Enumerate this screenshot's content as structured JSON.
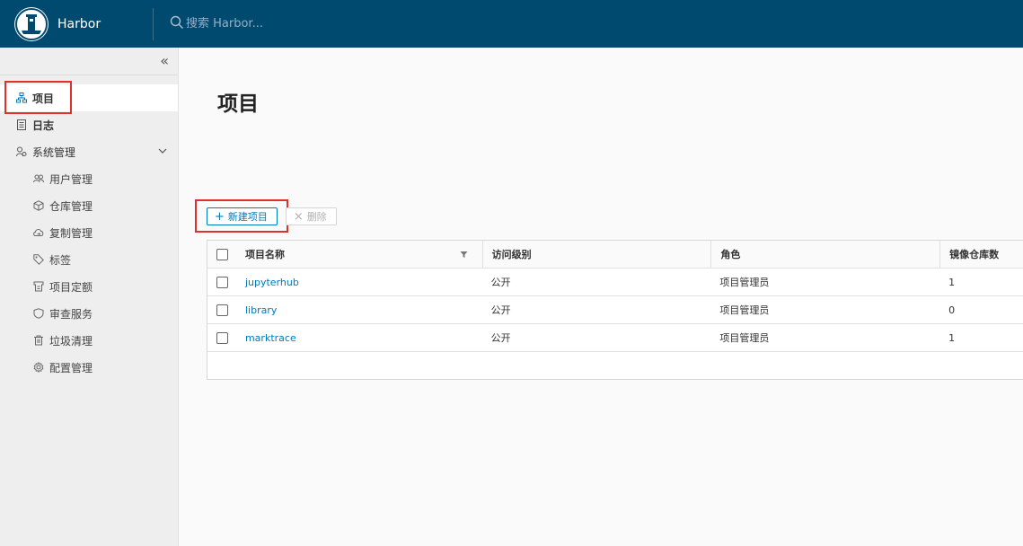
{
  "app": {
    "name": "Harbor"
  },
  "search": {
    "placeholder": "搜索 Harbor..."
  },
  "sidebar": {
    "collapse_icon": "«",
    "items": [
      {
        "label": "项目",
        "icon": "projects-icon"
      },
      {
        "label": "日志",
        "icon": "logs-icon"
      },
      {
        "label": "系统管理",
        "icon": "admin-icon"
      }
    ],
    "sub_items": [
      {
        "label": "用户管理",
        "icon": "users-icon"
      },
      {
        "label": "仓库管理",
        "icon": "registry-icon"
      },
      {
        "label": "复制管理",
        "icon": "replication-icon"
      },
      {
        "label": "标签",
        "icon": "tag-icon"
      },
      {
        "label": "项目定额",
        "icon": "quota-icon"
      },
      {
        "label": "审查服务",
        "icon": "shield-icon"
      },
      {
        "label": "垃圾清理",
        "icon": "trash-icon"
      },
      {
        "label": "配置管理",
        "icon": "gear-icon"
      }
    ]
  },
  "main": {
    "title": "项目",
    "new_button": "新建项目",
    "delete_button": "删除"
  },
  "table": {
    "headers": [
      "项目名称",
      "访问级别",
      "角色",
      "镜像仓库数"
    ],
    "rows": [
      {
        "name": "jupyterhub",
        "access": "公开",
        "role": "项目管理员",
        "repos": "1"
      },
      {
        "name": "library",
        "access": "公开",
        "role": "项目管理员",
        "repos": "0"
      },
      {
        "name": "marktrace",
        "access": "公开",
        "role": "项目管理员",
        "repos": "1"
      }
    ]
  },
  "colors": {
    "header_bg": "#004a70",
    "accent": "#0079b8",
    "highlight": "#e0302b"
  }
}
